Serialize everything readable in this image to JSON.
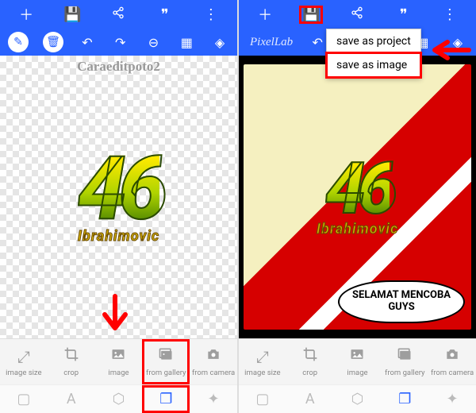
{
  "watermark": "Caraeditpoto2",
  "brand": "PixelLab",
  "art": {
    "number": "46",
    "name": "Ibrahimovic"
  },
  "speech": "SELAMAT\nMENCOBA GUYS",
  "save_menu": {
    "project": "save as project",
    "image": "save as image"
  },
  "top_icons": {
    "add": "＋",
    "save": "💾",
    "share": "�른",
    "quote": "❞",
    "more": "⋮"
  },
  "second_icons": {
    "edit": "✎",
    "trash": "🗑",
    "undo": "↶",
    "redo": "↷",
    "zoomout": "⊖",
    "grid": "▦",
    "layers": "◈"
  },
  "bottom": {
    "image_size": "image size",
    "crop": "crop",
    "image": "image",
    "from_gallery": "from gallery",
    "from_camera": "from camera"
  },
  "bottom_icons": {
    "image_size": "⤢",
    "crop": "✂",
    "image": "🖼",
    "from_gallery": "🖼",
    "from_camera": "📷"
  },
  "nav_icons": {
    "box": "▢",
    "text": "A",
    "shape": "⬡",
    "layers": "❐",
    "fx": "✦"
  }
}
